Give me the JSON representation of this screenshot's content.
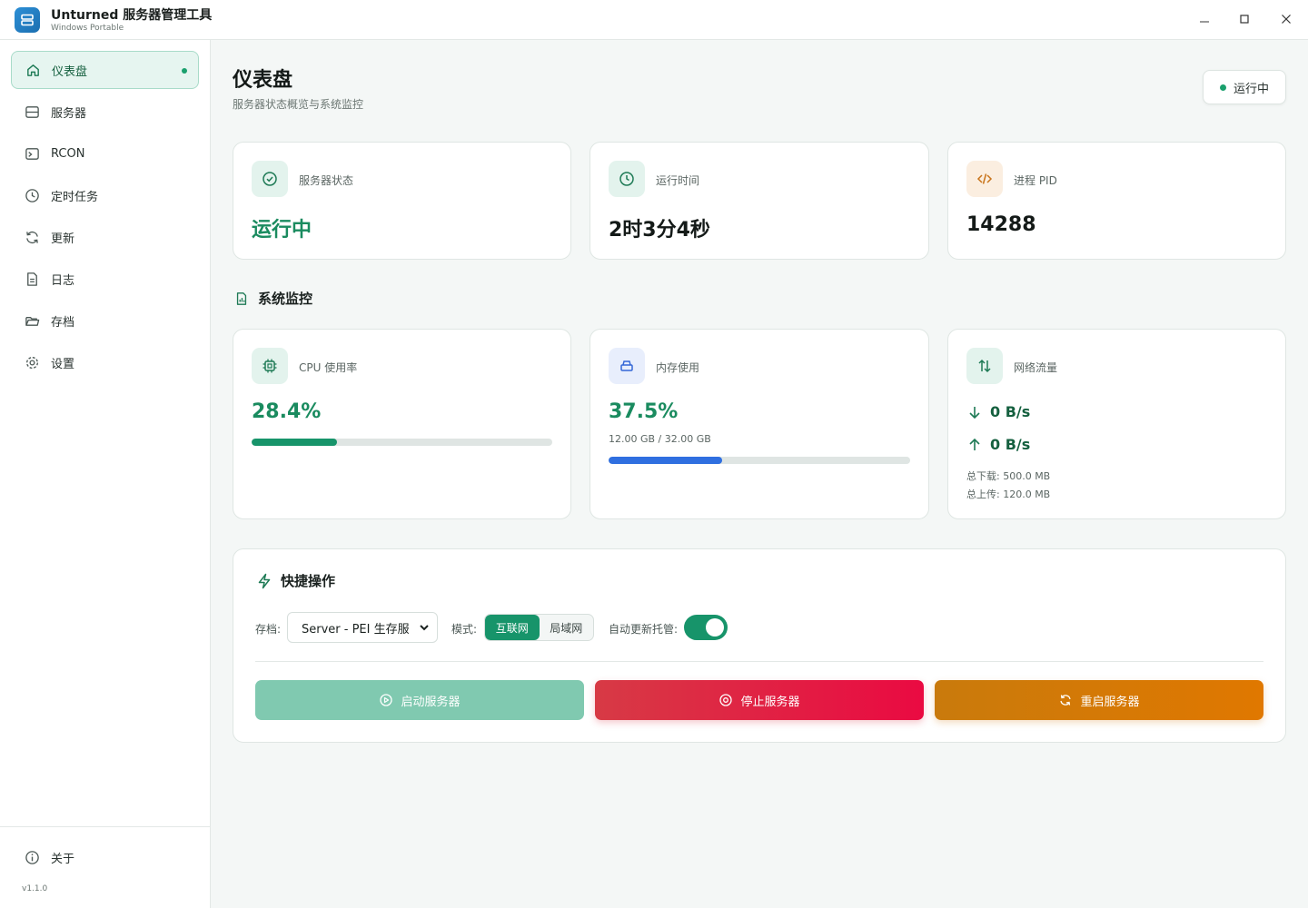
{
  "app": {
    "title": "Unturned 服务器管理工具",
    "subtitle": "Windows Portable",
    "version": "v1.1.0"
  },
  "window_controls": [
    "minimize",
    "maximize",
    "close"
  ],
  "sidebar": {
    "items": [
      {
        "label": "仪表盘",
        "icon": "home-icon",
        "active": true
      },
      {
        "label": "服务器",
        "icon": "server-icon",
        "active": false
      },
      {
        "label": "RCON",
        "icon": "terminal-icon",
        "active": false
      },
      {
        "label": "定时任务",
        "icon": "clock-icon",
        "active": false
      },
      {
        "label": "更新",
        "icon": "refresh-icon",
        "active": false
      },
      {
        "label": "日志",
        "icon": "file-icon",
        "active": false
      },
      {
        "label": "存档",
        "icon": "folder-icon",
        "active": false
      },
      {
        "label": "设置",
        "icon": "gear-icon",
        "active": false
      }
    ],
    "footer_item": {
      "label": "关于",
      "icon": "info-icon"
    }
  },
  "header": {
    "title": "仪表盘",
    "subtitle": "服务器状态概览与系统监控",
    "status_label": "运行中"
  },
  "status_cards": [
    {
      "label": "服务器状态",
      "value": "运行中",
      "icon": "check-circle-icon"
    },
    {
      "label": "运行时间",
      "value": "2时3分4秒",
      "icon": "clock-icon"
    },
    {
      "label": "进程 PID",
      "value": "14288",
      "icon": "code-icon"
    }
  ],
  "monitor": {
    "title": "系统监控",
    "cpu": {
      "label": "CPU 使用率",
      "value": "28.4%",
      "percent": 28.4
    },
    "memory": {
      "label": "内存使用",
      "value": "37.5%",
      "percent": 37.5,
      "detail": "12.00 GB / 32.00 GB"
    },
    "network": {
      "label": "网络流量",
      "down": "0 B/s",
      "up": "0 B/s",
      "total_down": "总下载: 500.0 MB",
      "total_up": "总上传: 120.0 MB"
    }
  },
  "quick_actions": {
    "title": "快捷操作",
    "save_label": "存档:",
    "save_value": "Server - PEI 生存服",
    "mode_label": "模式:",
    "mode_options": [
      "互联网",
      "局域网"
    ],
    "mode_selected": "互联网",
    "auto_update_label": "自动更新托管:",
    "auto_update_on": true,
    "start_label": "启动服务器",
    "stop_label": "停止服务器",
    "restart_label": "重启服务器"
  },
  "colors": {
    "accent": "#17946a",
    "running": "#1aa06d",
    "memory_bar": "#2f6fe0",
    "stop": "#e0203f",
    "restart": "#d97a05"
  }
}
